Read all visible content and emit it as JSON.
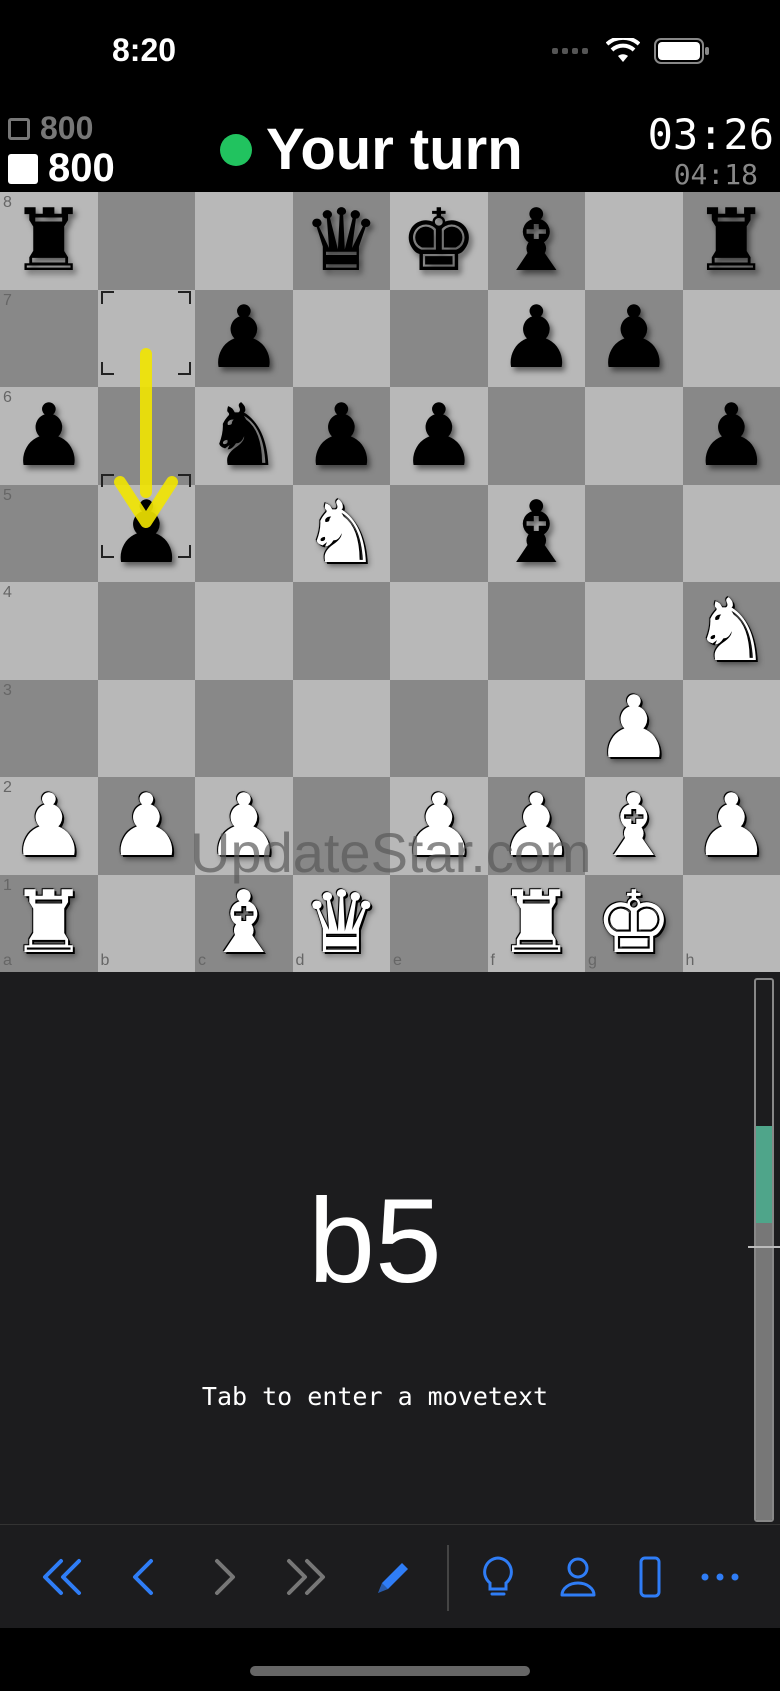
{
  "status_bar": {
    "time": "8:20"
  },
  "header": {
    "opponent_score": "800",
    "player_score": "800",
    "turn_text": "Your turn",
    "clock_main": "03:26",
    "clock_sub": "04:18"
  },
  "board": {
    "rank_labels": [
      "8",
      "7",
      "6",
      "5",
      "4",
      "3",
      "2",
      "1"
    ],
    "file_labels": [
      "a",
      "b",
      "c",
      "d",
      "e",
      "f",
      "g",
      "h"
    ],
    "position_rows": [
      [
        "bR",
        "",
        "",
        "bQ",
        "bK",
        "bB",
        "",
        "bR"
      ],
      [
        "",
        "",
        "bP",
        "",
        "",
        "bP",
        "bP",
        ""
      ],
      [
        "bP",
        "",
        "bN",
        "bP",
        "bP",
        "",
        "",
        "bP"
      ],
      [
        "",
        "bP",
        "",
        "wN",
        "",
        "bB",
        "",
        ""
      ],
      [
        "",
        "",
        "",
        "",
        "",
        "",
        "",
        "wN"
      ],
      [
        "",
        "",
        "",
        "",
        "",
        "",
        "wP",
        ""
      ],
      [
        "wP",
        "wP",
        "wP",
        "",
        "wP",
        "wP",
        "wB",
        "wP"
      ],
      [
        "wR",
        "",
        "wB",
        "wQ",
        "",
        "wR",
        "wK",
        ""
      ]
    ],
    "last_move_from": "b7",
    "last_move_to": "b5",
    "arrow_color": "#f2e600",
    "watermark": "UpdateStar.com"
  },
  "move_panel": {
    "move": "b5",
    "hint": "Tab to enter a movetext",
    "eval_green_fraction": 0.18
  },
  "toolbar": {
    "accent_color": "#2f7df6",
    "icons": [
      "first-move-icon",
      "previous-move-icon",
      "next-move-icon",
      "last-move-icon",
      "edit-pencil-icon",
      "hint-bulb-icon",
      "player-icon",
      "device-icon",
      "more-icon"
    ]
  }
}
